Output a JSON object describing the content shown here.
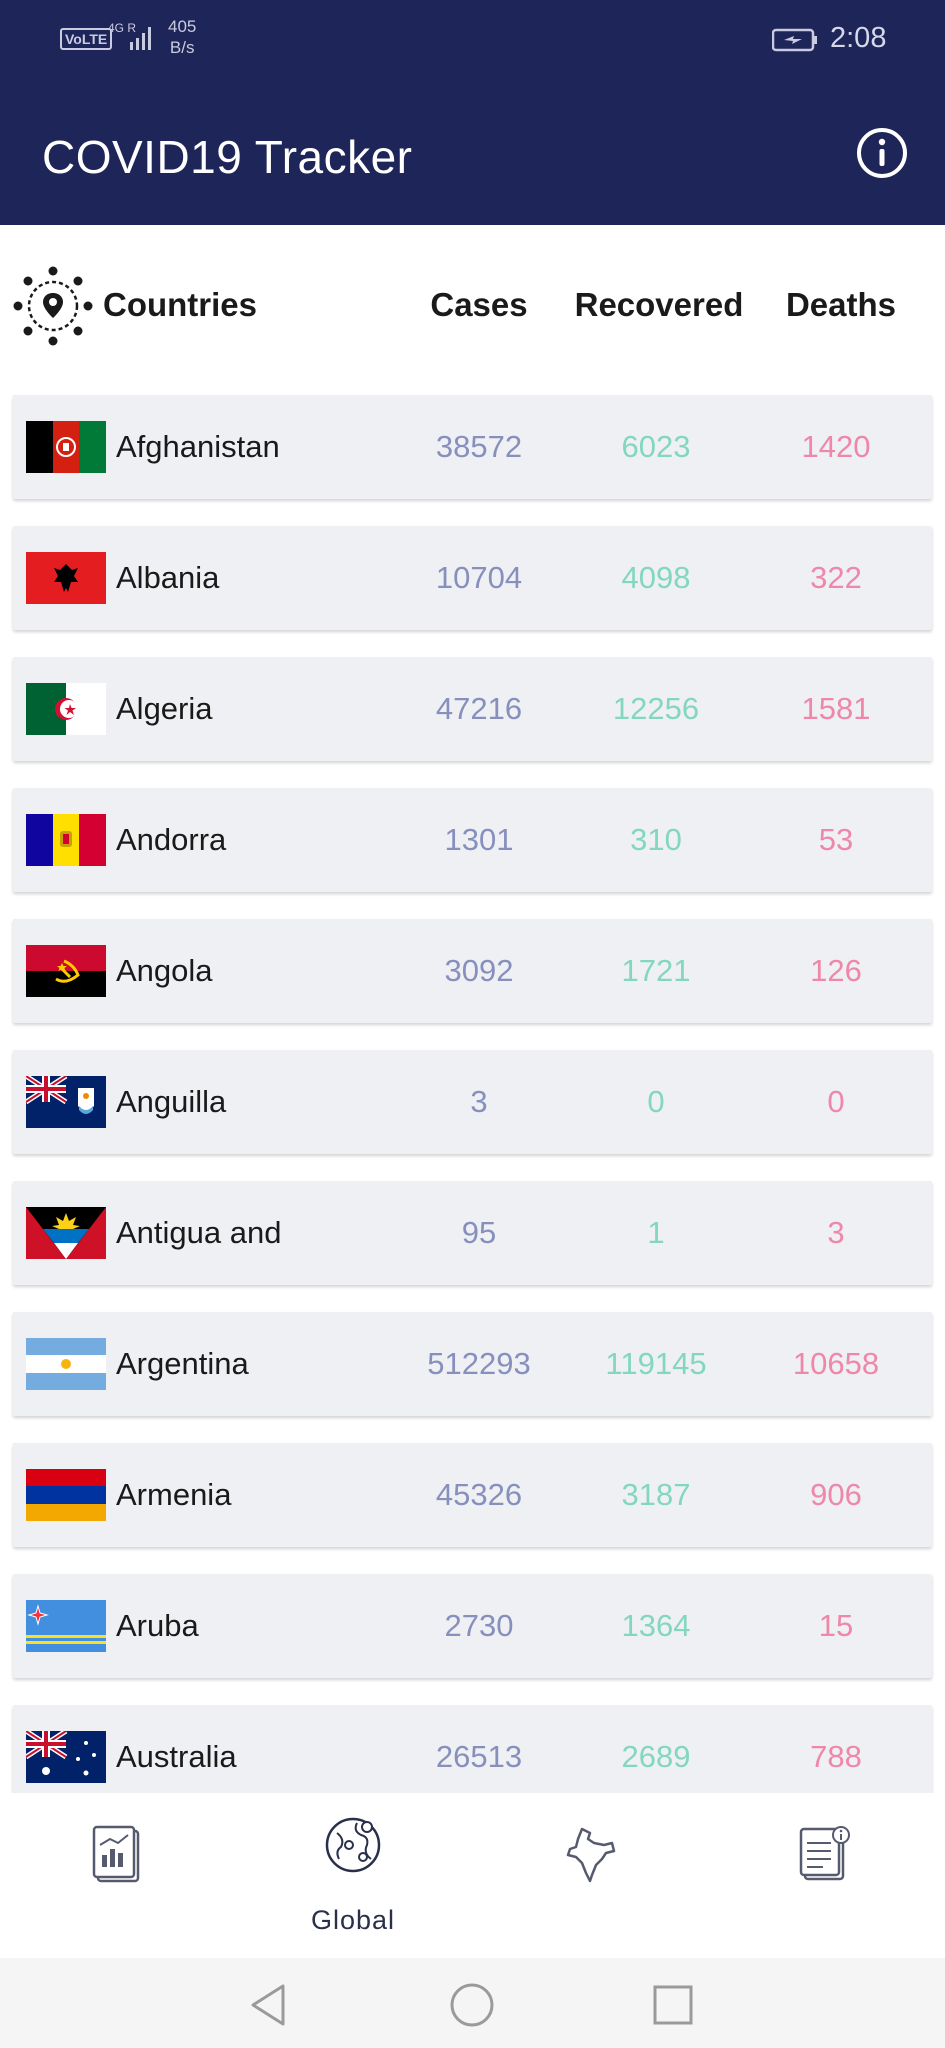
{
  "status_bar": {
    "network_badge": "VoLTE",
    "network_type": "4G R",
    "speed_value": "405",
    "speed_unit": "B/s",
    "time": "2:08"
  },
  "app_bar": {
    "title": "COVID19 Tracker",
    "info_icon": "info-circle-icon"
  },
  "table_header": {
    "countries": "Countries",
    "cases": "Cases",
    "recovered": "Recovered",
    "deaths": "Deaths"
  },
  "countries": [
    {
      "name": "Afghanistan",
      "cases": "38572",
      "recovered": "6023",
      "deaths": "1420"
    },
    {
      "name": "Albania",
      "cases": "10704",
      "recovered": "4098",
      "deaths": "322"
    },
    {
      "name": "Algeria",
      "cases": "47216",
      "recovered": "12256",
      "deaths": "1581"
    },
    {
      "name": "Andorra",
      "cases": "1301",
      "recovered": "310",
      "deaths": "53"
    },
    {
      "name": "Angola",
      "cases": "3092",
      "recovered": "1721",
      "deaths": "126"
    },
    {
      "name": "Anguilla",
      "cases": "3",
      "recovered": "0",
      "deaths": "0"
    },
    {
      "name": "Antigua and",
      "cases": "95",
      "recovered": "1",
      "deaths": "3"
    },
    {
      "name": "Argentina",
      "cases": "512293",
      "recovered": "119145",
      "deaths": "10658"
    },
    {
      "name": "Armenia",
      "cases": "45326",
      "recovered": "3187",
      "deaths": "906"
    },
    {
      "name": "Aruba",
      "cases": "2730",
      "recovered": "1364",
      "deaths": "15"
    },
    {
      "name": "Australia",
      "cases": "26513",
      "recovered": "2689",
      "deaths": "788"
    }
  ],
  "colors": {
    "app_bar": "#1e2558",
    "cases": "#8790bd",
    "recovered": "#83d7be",
    "deaths": "#ee87a8",
    "row_background": "#eff0f3"
  },
  "bottom_nav": {
    "items": [
      {
        "icon": "stats-report-icon",
        "label": ""
      },
      {
        "icon": "globe-network-icon",
        "label": "Global",
        "active": true
      },
      {
        "icon": "india-map-icon",
        "label": ""
      },
      {
        "icon": "document-info-icon",
        "label": ""
      }
    ]
  },
  "system_nav": {
    "back": "back-triangle-icon",
    "home": "home-circle-icon",
    "recents": "recents-square-icon"
  }
}
